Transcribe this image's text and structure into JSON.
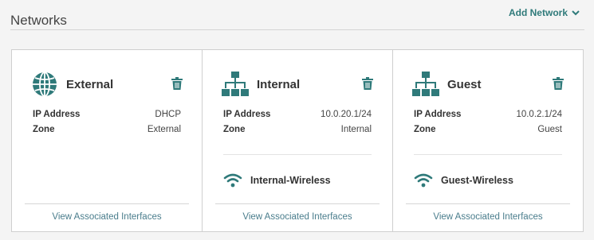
{
  "header": {
    "title": "Networks",
    "add_label": "Add Network"
  },
  "colors": {
    "accent": "#2f7a7a",
    "link": "#4a7d8c"
  },
  "networks": [
    {
      "name": "External",
      "icon": "globe-icon",
      "ip_label": "IP Address",
      "ip_value": "DHCP",
      "zone_label": "Zone",
      "zone_value": "External",
      "wireless": null,
      "view_label": "View Associated Interfaces"
    },
    {
      "name": "Internal",
      "icon": "network-tree-icon",
      "ip_label": "IP Address",
      "ip_value": "10.0.20.1/24",
      "zone_label": "Zone",
      "zone_value": "Internal",
      "wireless": "Internal-Wireless",
      "view_label": "View Associated Interfaces"
    },
    {
      "name": "Guest",
      "icon": "network-tree-icon",
      "ip_label": "IP Address",
      "ip_value": "10.0.2.1/24",
      "zone_label": "Zone",
      "zone_value": "Guest",
      "wireless": "Guest-Wireless",
      "view_label": "View Associated Interfaces"
    }
  ]
}
